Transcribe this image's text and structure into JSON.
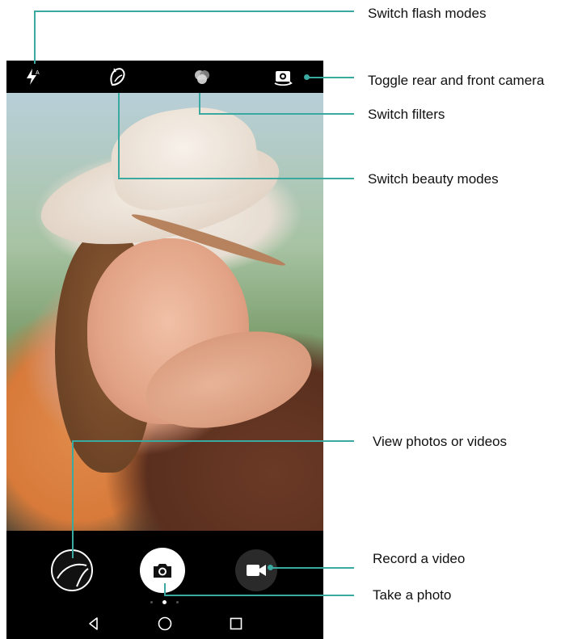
{
  "colors": {
    "callout_line": "#3aa9a0",
    "bar_background": "#000000",
    "icon_white": "#ffffff"
  },
  "top_bar": {
    "icons": [
      "flash-icon",
      "beauty-mode-icon",
      "filters-icon",
      "switch-camera-icon"
    ]
  },
  "bottom_bar": {
    "icons": [
      "gallery-icon",
      "camera-icon",
      "video-icon"
    ],
    "page_dots": 3,
    "active_dot": 1
  },
  "nav_bar": {
    "icons": [
      "back-icon",
      "home-icon",
      "recents-icon"
    ]
  },
  "callouts": {
    "flash": "Switch flash modes",
    "camera_toggle": "Toggle rear and front camera",
    "filters": "Switch filters",
    "beauty": "Switch beauty modes",
    "gallery": "View photos or videos",
    "video": "Record a video",
    "photo": "Take a photo"
  }
}
